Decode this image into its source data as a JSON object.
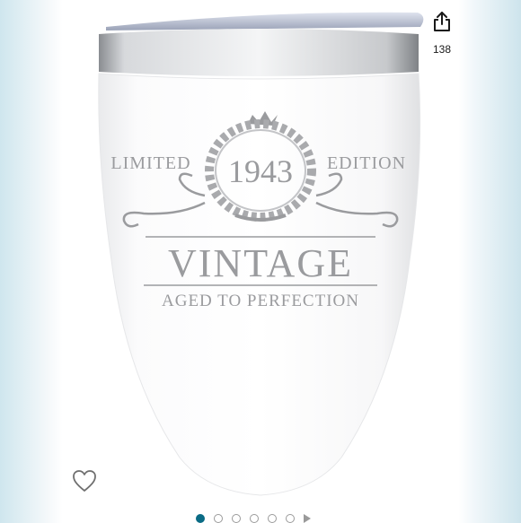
{
  "product": {
    "engraving": {
      "left_word": "LIMITED",
      "year": "1943",
      "right_word": "EDITION",
      "headline": "VINTAGE",
      "subline": "AGED TO PERFECTION"
    },
    "colors": {
      "body": "#ffffff",
      "engraving": "#9a9b9e",
      "rim": "#b9bcc0"
    }
  },
  "actions": {
    "share_count": "138"
  },
  "gallery": {
    "total_items": 7,
    "active_index": 0,
    "has_video_indicator": true,
    "active_color": "#0a6b85"
  }
}
